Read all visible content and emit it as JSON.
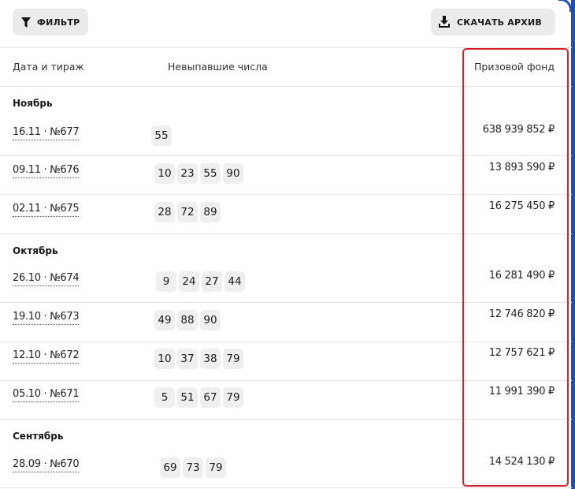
{
  "toolbar": {
    "filter_label": "ФИЛЬТР",
    "download_label": "СКАЧАТЬ АРХИВ"
  },
  "table": {
    "headers": {
      "date": "Дата и тираж",
      "numbers": "Невыпавшие числа",
      "prize": "Призовой фонд"
    },
    "groups": [
      {
        "month": "Ноябрь",
        "rows": [
          {
            "draw": "16.11 · №677",
            "numbers": [
              "55"
            ],
            "prize": "638 939 852 ₽"
          },
          {
            "draw": "09.11 · №676",
            "numbers": [
              "10",
              "23",
              "55",
              "90"
            ],
            "prize": "13 893 590 ₽"
          },
          {
            "draw": "02.11 · №675",
            "numbers": [
              "28",
              "72",
              "89"
            ],
            "prize": "16 275 450 ₽"
          }
        ]
      },
      {
        "month": "Октябрь",
        "rows": [
          {
            "draw": "26.10 · №674",
            "numbers": [
              "9",
              "24",
              "27",
              "44"
            ],
            "prize": "16 281 490 ₽"
          },
          {
            "draw": "19.10 · №673",
            "numbers": [
              "49",
              "88",
              "90"
            ],
            "prize": "12 746 820 ₽"
          },
          {
            "draw": "12.10 · №672",
            "numbers": [
              "10",
              "37",
              "38",
              "79"
            ],
            "prize": "12 757 621 ₽"
          },
          {
            "draw": "05.10 · №671",
            "numbers": [
              "5",
              "51",
              "67",
              "79"
            ],
            "prize": "11 991 390 ₽"
          }
        ]
      },
      {
        "month": "Сентябрь",
        "rows": [
          {
            "draw": "28.09 · №670",
            "numbers": [
              "69",
              "73",
              "79"
            ],
            "prize": "14 524 130 ₽"
          }
        ]
      }
    ]
  },
  "colors": {
    "highlight": "#d8232a",
    "chip_bg": "#efefef",
    "button_bg": "#ebebeb"
  }
}
